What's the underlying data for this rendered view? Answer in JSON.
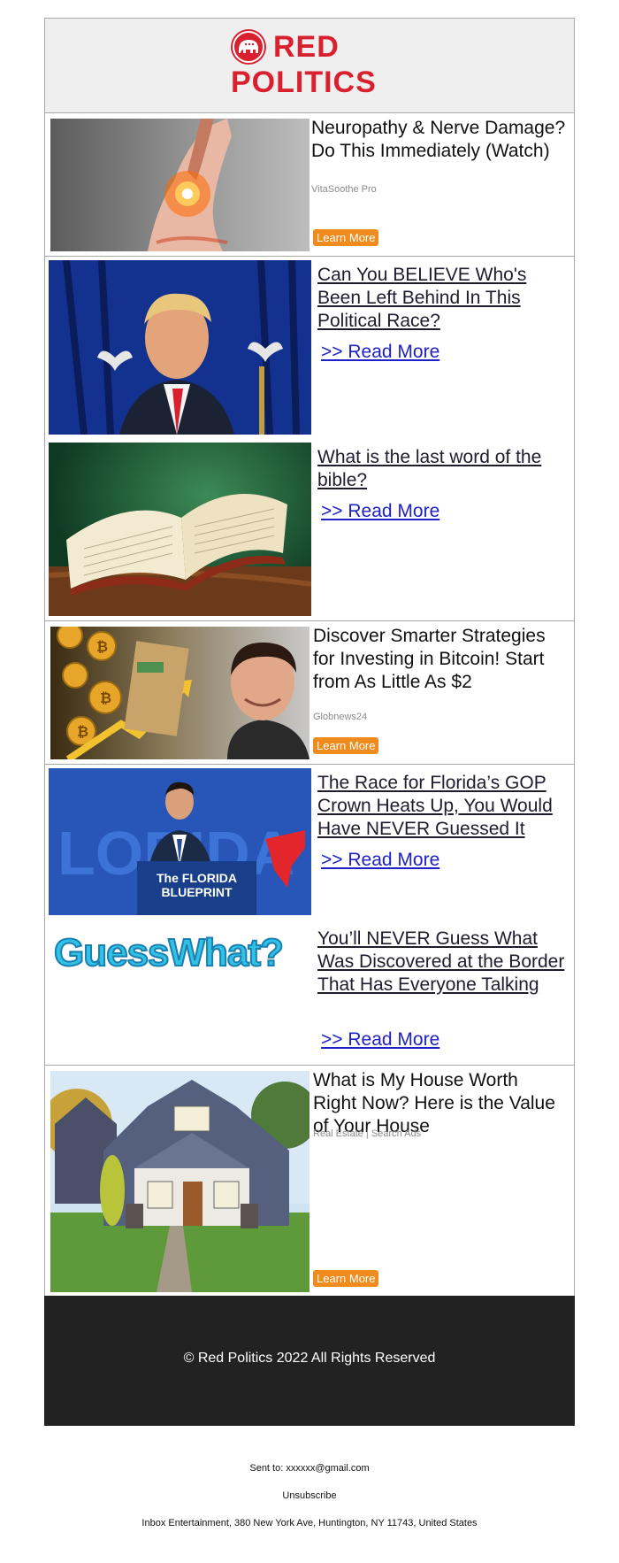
{
  "brand": {
    "line1": "RED",
    "line2": "POLITICS",
    "color": "#d8202f"
  },
  "ads": [
    {
      "title": "Neuropathy & Nerve Damage? Do This Immediately (Watch)",
      "source": "VitaSoothe Pro",
      "button": "Learn More",
      "image": "foot-pain-image"
    },
    {
      "title": "Discover Smarter Strategies for Investing in Bitcoin! Start from As Little As $2",
      "source": "Globnews24",
      "button": "Learn More",
      "image": "bitcoin-man-image"
    },
    {
      "title": "What is My House Worth Right Now? Here is the Value of Your House",
      "source": "Real Estate | Search Ads",
      "button": "Learn More",
      "image": "house-image"
    }
  ],
  "articles": [
    {
      "title": "Can You BELIEVE Who's Been Left Behind In This Political Race?",
      "read_more": ">> Read More",
      "image": "politician-portrait-image"
    },
    {
      "title": "What is the last word of the bible?",
      "read_more": ">> Read More",
      "image": "open-bible-image"
    },
    {
      "title": "The Race for Florida’s GOP Crown Heats Up, You Would Have NEVER Guessed It",
      "read_more": ">> Read More",
      "image": "florida-blueprint-speaker-image",
      "image_text": "The FLORIDA BLUEPRINT"
    },
    {
      "title": "You’ll NEVER Guess What Was Discovered at the Border That Has Everyone Talking",
      "read_more": ">> Read More",
      "image": "guess-what-logo-image",
      "image_text": "GuessWhat?"
    }
  ],
  "footer": {
    "copyright": "© Red Politics 2022 All Rights Reserved"
  },
  "meta": {
    "sent_to": "Sent to: xxxxxx@gmail.com",
    "unsubscribe": "Unsubscribe",
    "address": "Inbox Entertainment, 380 New York Ave, Huntington, NY 11743, United States"
  },
  "colors": {
    "accent": "#d8202f",
    "button": "#f08b1d",
    "link": "#1f21c8",
    "footer": "#222222"
  }
}
